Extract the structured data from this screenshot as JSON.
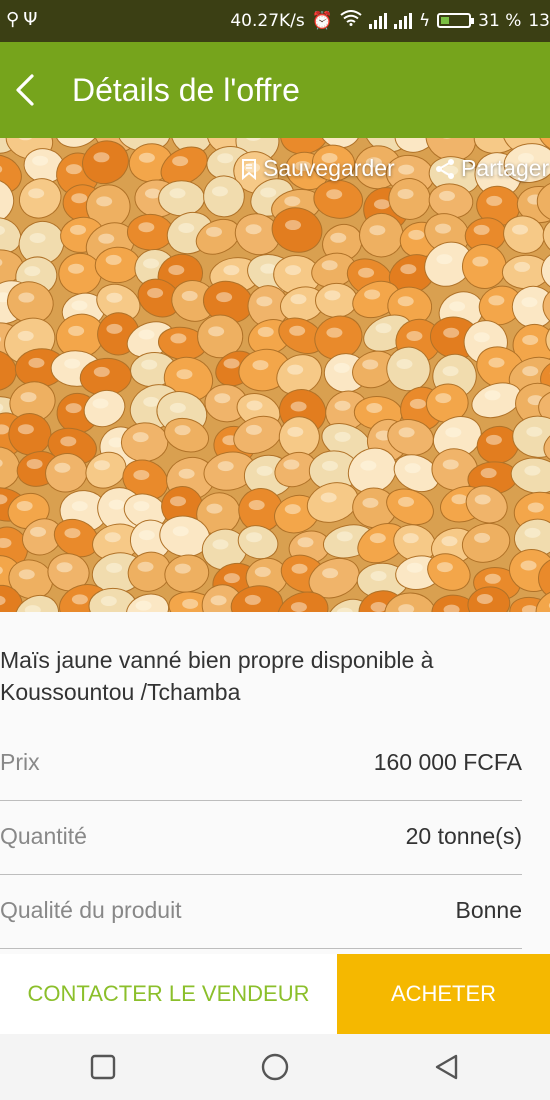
{
  "status_bar": {
    "left_icons": [
      "usb-icon",
      "usb-icon"
    ],
    "speed": "40.27K/s",
    "battery_percent": "31 %",
    "battery_level": 0.31,
    "time": "13"
  },
  "app_bar": {
    "title": "Détails de l'offre",
    "back_icon": "chevron-left-icon"
  },
  "hero": {
    "save_label": "Sauvegarder",
    "share_label": "Partager"
  },
  "offer": {
    "description": "Maïs jaune vanné bien propre disponible à Koussountou /Tchamba",
    "rows": [
      {
        "label": "Prix",
        "value": "160 000 FCFA"
      },
      {
        "label": "Quantité",
        "value": "20 tonne(s)"
      },
      {
        "label": "Qualité du produit",
        "value": "Bonne"
      }
    ]
  },
  "actions": {
    "contact_label": "CONTACTER LE VENDEUR",
    "buy_label": "ACHETER"
  },
  "colors": {
    "app_bar": "#76a41c",
    "status_bar": "#3b3f14",
    "contact_text": "#8bbf2b",
    "buy_button": "#f5b800"
  }
}
